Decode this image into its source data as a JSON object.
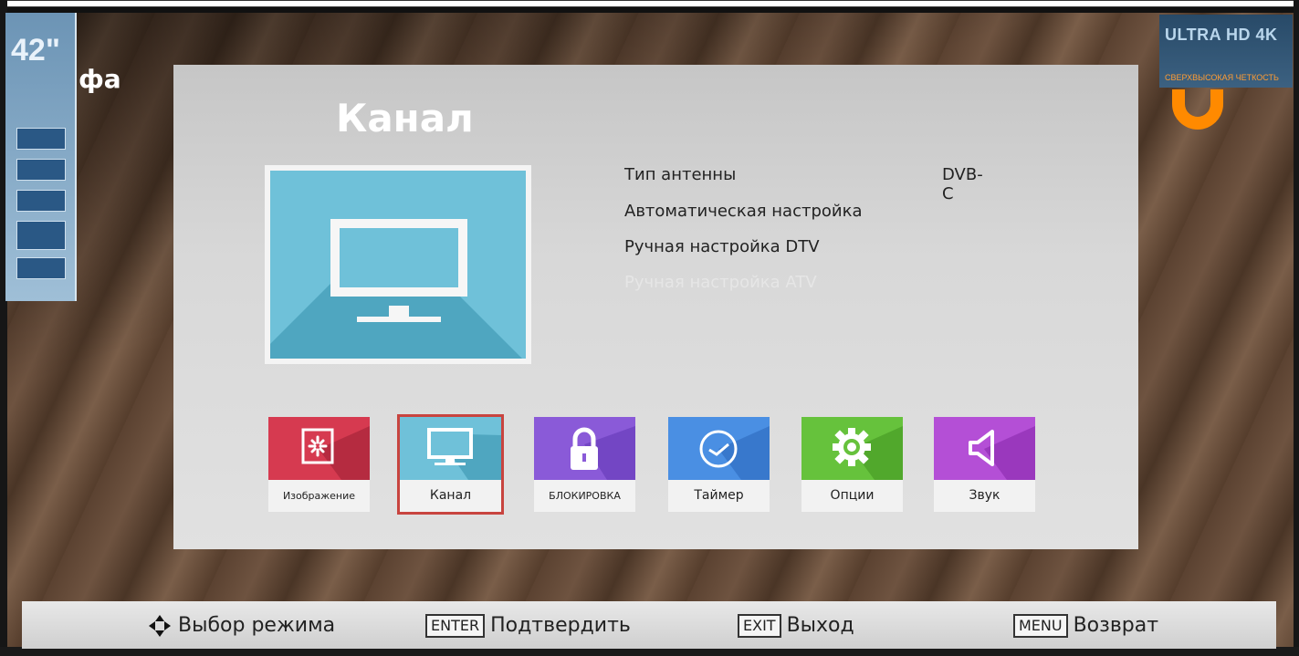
{
  "overlay": {
    "city_text": "фа",
    "sticker_size": "42\"",
    "brand_text": "ULTRA HD 4K",
    "brand_sub": "СВЕРХВЫСОКАЯ ЧЕТКОСТЬ"
  },
  "panel": {
    "title": "Канал",
    "settings": [
      {
        "label": "Тип антенны",
        "value": "DVB-C",
        "enabled": true
      },
      {
        "label": "Автоматическая настройка",
        "value": "",
        "enabled": true
      },
      {
        "label": "Ручная настройка DTV",
        "value": "",
        "enabled": true
      },
      {
        "label": "Ручная настройка ATV",
        "value": "",
        "enabled": false
      }
    ]
  },
  "categories": [
    {
      "label": "Изображение",
      "icon": "picture-icon",
      "color": "#d63a50",
      "selected": false
    },
    {
      "label": "Канал",
      "icon": "tv-icon",
      "color": "#6fc1d9",
      "selected": true
    },
    {
      "label": "БЛОКИРОВКА",
      "icon": "lock-icon",
      "color": "#8a5ad8",
      "selected": false
    },
    {
      "label": "Таймер",
      "icon": "clock-icon",
      "color": "#4a8fe3",
      "selected": false
    },
    {
      "label": "Опции",
      "icon": "gear-icon",
      "color": "#66c23c",
      "selected": false
    },
    {
      "label": "Звук",
      "icon": "speaker-icon",
      "color": "#b44fd6",
      "selected": false
    }
  ],
  "helpbar": {
    "select_mode": "Выбор режима",
    "enter_key": "ENTER",
    "confirm": "Подтвердить",
    "exit_key": "EXIT",
    "exit": "Выход",
    "menu_key": "MENU",
    "back": "Возврат"
  }
}
